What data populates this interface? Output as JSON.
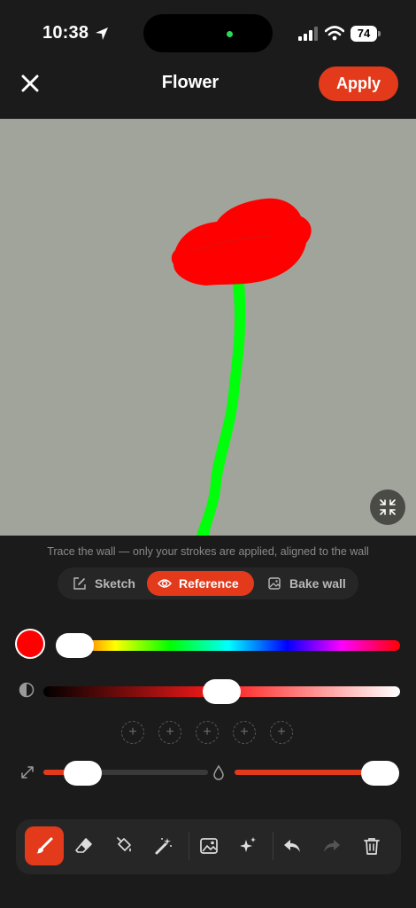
{
  "status_bar": {
    "time": "10:38",
    "battery": "74"
  },
  "header": {
    "title": "Flower",
    "apply_label": "Apply"
  },
  "hint": "Trace the wall — only your strokes are applied, aligned to the wall",
  "modes": [
    {
      "label": "Sketch",
      "icon": "edit-icon",
      "selected": false
    },
    {
      "label": "Reference",
      "icon": "eye-icon",
      "selected": true
    },
    {
      "label": "Bake wall",
      "icon": "image-icon",
      "selected": false
    }
  ],
  "colors": {
    "accent": "#e33a1c",
    "selected_color": "#fe0000",
    "canvas_bg": "#a1a49b",
    "stem": "#00ff0b"
  },
  "sliders": {
    "hue": 0.0,
    "lightness": 0.5,
    "brush_size": 0.1,
    "opacity": 1.0
  },
  "tools": [
    "brush-icon",
    "eraser-icon",
    "fill-icon",
    "magic-wand-icon",
    "image-icon",
    "sparkles-icon",
    "undo-icon",
    "redo-icon",
    "trash-icon"
  ]
}
